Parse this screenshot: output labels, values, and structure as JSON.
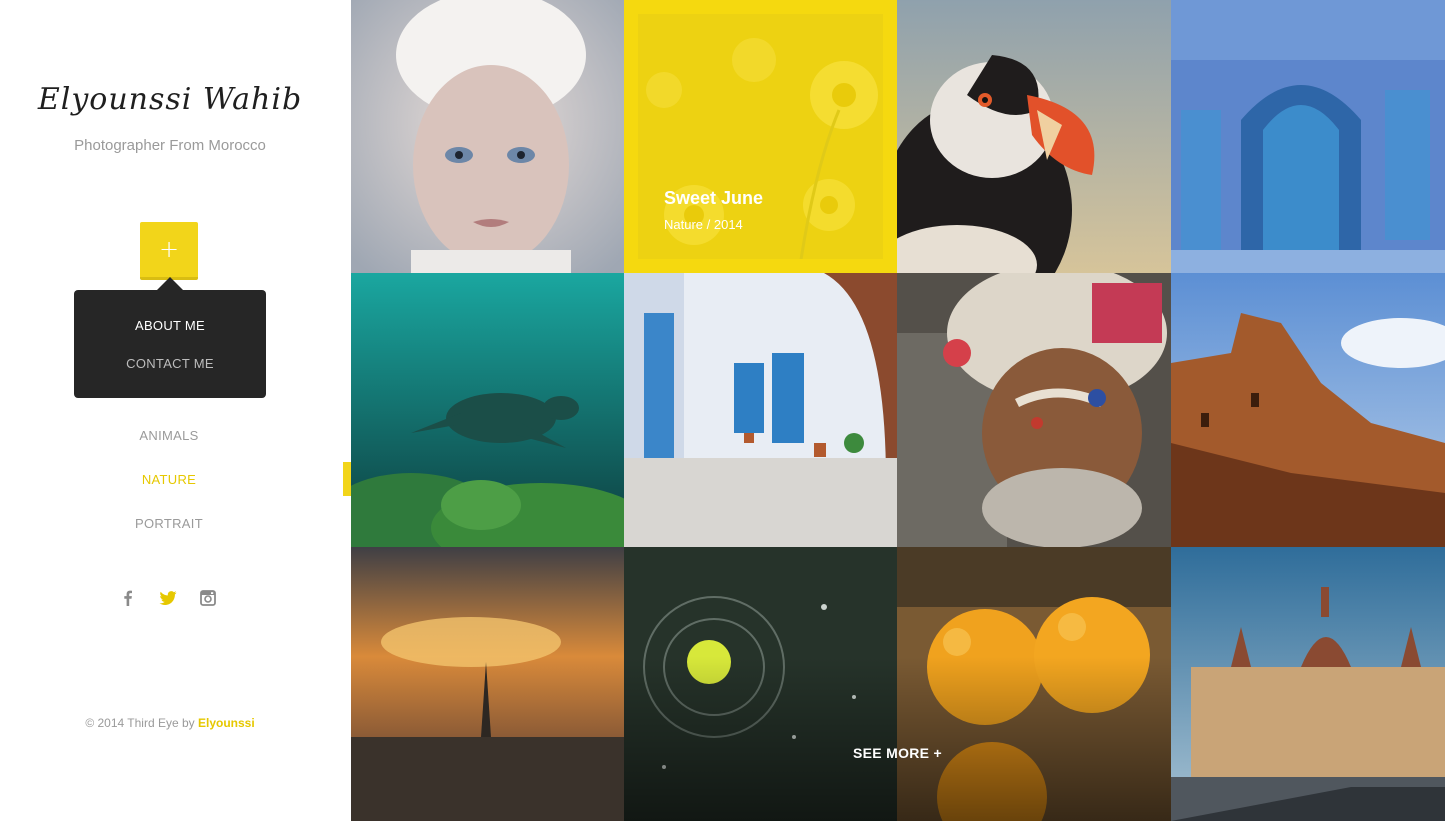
{
  "sidebar": {
    "brand_name": "Elyounssi Wahib",
    "tagline": "Photographer From Morocco",
    "menu_toggle_symbol": "+",
    "menu": {
      "items": [
        {
          "label": "ABOUT ME"
        },
        {
          "label": "CONTACT ME"
        }
      ]
    },
    "categories": [
      {
        "label": "ANIMALS",
        "active": false
      },
      {
        "label": "NATURE",
        "active": true
      },
      {
        "label": "PORTRAIT",
        "active": false
      }
    ],
    "social": [
      {
        "icon": "facebook-icon",
        "color": "#8a8a8a"
      },
      {
        "icon": "twitter-icon",
        "color": "#e6c800"
      },
      {
        "icon": "instagram-icon",
        "color": "#8a8a8a"
      }
    ],
    "copyright": {
      "prefix": "© 2014 Third Eye by ",
      "author": "Elyounssi"
    }
  },
  "gallery": {
    "tiles": [
      {
        "subject": "portrait-boy-photo"
      },
      {
        "subject": "yellow-flowers-photo",
        "overlay": {
          "title": "Sweet June",
          "meta": "Nature / 2014"
        }
      },
      {
        "subject": "puffin-photo"
      },
      {
        "subject": "blue-door-photo"
      },
      {
        "subject": "sea-turtle-photo"
      },
      {
        "subject": "blue-alley-photo"
      },
      {
        "subject": "sadhu-portrait-photo"
      },
      {
        "subject": "kasbah-photo"
      },
      {
        "subject": "paris-sunset-photo"
      },
      {
        "subject": "tennis-ball-photo"
      },
      {
        "subject": "oranges-photo"
      },
      {
        "subject": "budapest-parliament-photo"
      }
    ],
    "see_more_label": "SEE MORE +"
  },
  "colors": {
    "accent": "#f2d51a",
    "menu_bg": "#262626",
    "muted_text": "#9a9a9a"
  }
}
